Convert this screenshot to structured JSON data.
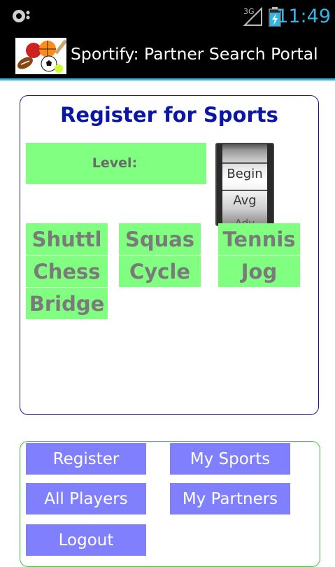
{
  "status_bar": {
    "network": "3G",
    "time": "11:49",
    "left_icon": "headset-icon",
    "battery_icon": "battery-charging-icon",
    "signal_icon": "signal-icon"
  },
  "title_bar": {
    "logo_icon": "sports-balls-logo",
    "title": "Sportify: Partner Search Portal"
  },
  "register_panel": {
    "heading": "Register for Sports",
    "level_label": "Level:",
    "level_picker": {
      "options": [
        "Begin",
        "Avg",
        "Adv"
      ],
      "selected": "Begin"
    },
    "sports": [
      "Shuttl",
      "Squas",
      "Tennis",
      "Chess",
      "Cycle",
      "Jog",
      "Bridge"
    ]
  },
  "nav": {
    "register": "Register",
    "my_sports": "My Sports",
    "all_players": "All Players",
    "my_partners": "My Partners",
    "logout": "Logout"
  },
  "colors": {
    "status_clock": "#33b5e5",
    "accent_line": "#33b5e5",
    "heading": "#0a17a6",
    "tile_green": "#80ff80",
    "button_purple": "#8080ff",
    "panel_border": "#1a1a99",
    "nav_border": "#33cc33"
  }
}
